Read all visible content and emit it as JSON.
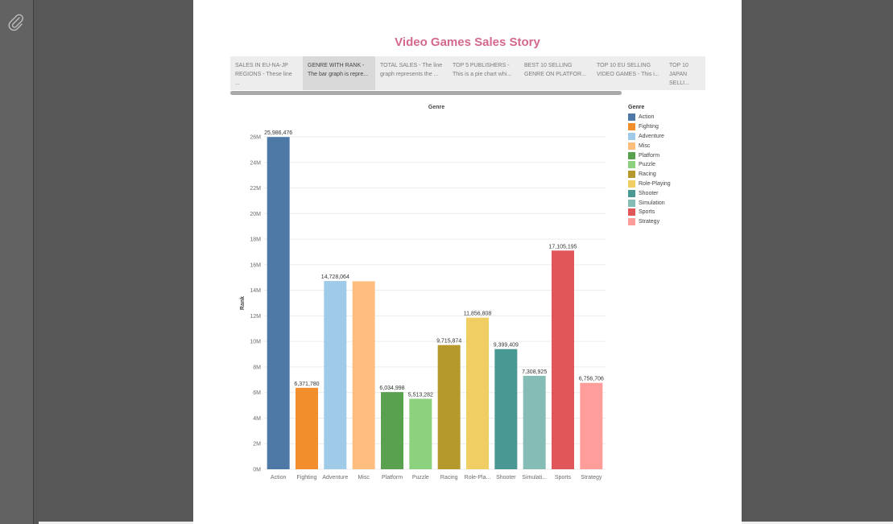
{
  "story": {
    "title": "Video Games Sales Story",
    "title_color": "#d4688f",
    "nav_points": [
      {
        "line1": "SALES IN EU-NA-JP",
        "line2": "REGIONS - These line ...",
        "active": false
      },
      {
        "line1": "GENRE WITH RANK -",
        "line2": "The bar graph is repre...",
        "active": true
      },
      {
        "line1": "TOTAL SALES - The line",
        "line2": "graph represents the ...",
        "active": false
      },
      {
        "line1": "TOP 5 PUBLISHERS -",
        "line2": "This is a pie chart whi...",
        "active": false
      },
      {
        "line1": "BEST 10 SELLING",
        "line2": "GENRE ON PLATFOR...",
        "active": false
      },
      {
        "line1": "TOP 10 EU SELLING",
        "line2": "VIDEO GAMES - This i...",
        "active": false
      },
      {
        "line1": "TOP 10",
        "line2": "JAPAN SELLI...",
        "active": false
      }
    ]
  },
  "icons": {
    "attachment": "paperclip-icon"
  },
  "chart_data": {
    "type": "bar",
    "title": "Genre",
    "xlabel": "",
    "ylabel": "Rank",
    "categories": [
      "Action",
      "Fighting",
      "Adventure",
      "Misc",
      "Platform",
      "Puzzle",
      "Racing",
      "Role-Pla...",
      "Shooter",
      "Simulati...",
      "Sports",
      "Strategy"
    ],
    "values": [
      25986476,
      6371780,
      14728064,
      14700000,
      6034998,
      5513282,
      9715874,
      11856808,
      9399409,
      7308925,
      17105195,
      6756706
    ],
    "data_labels": [
      "25,986,476",
      "6,371,780",
      "14,728,064",
      "",
      "6,034,998",
      "5,513,282",
      "9,715,874",
      "11,856,808",
      "9,399,409",
      "7,308,925",
      "17,105,195",
      "6,756,706"
    ],
    "colors": [
      "#4e79a7",
      "#f28e2b",
      "#a0cbe8",
      "#ffbe7d",
      "#59a14f",
      "#8cd17d",
      "#b6992d",
      "#f1ce63",
      "#499894",
      "#86bcb6",
      "#e15759",
      "#ff9d9a"
    ],
    "ylim": [
      0,
      26000000
    ],
    "yticks": [
      0,
      2000000,
      4000000,
      6000000,
      8000000,
      10000000,
      12000000,
      14000000,
      16000000,
      18000000,
      20000000,
      22000000,
      24000000,
      26000000
    ],
    "ytick_labels": [
      "0M",
      "2M",
      "4M",
      "6M",
      "8M",
      "10M",
      "12M",
      "14M",
      "16M",
      "18M",
      "20M",
      "22M",
      "24M",
      "26M"
    ],
    "grid": true,
    "legend": {
      "title": "Genre",
      "placement": "right",
      "items": [
        "Action",
        "Fighting",
        "Adventure",
        "Misc",
        "Platform",
        "Puzzle",
        "Racing",
        "Role-Playing",
        "Shooter",
        "Simulation",
        "Sports",
        "Strategy"
      ]
    }
  }
}
